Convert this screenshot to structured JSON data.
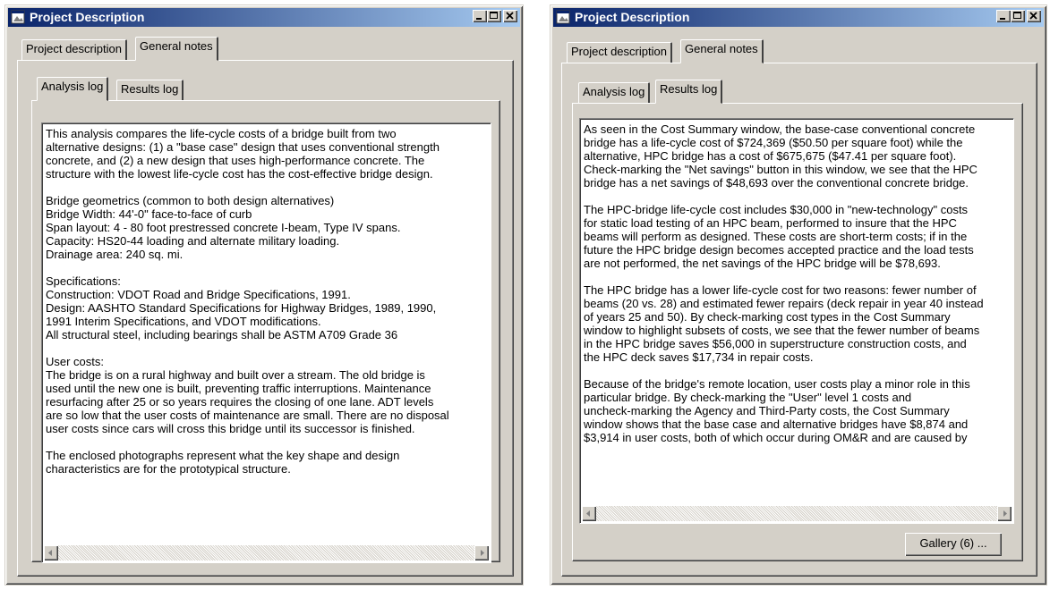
{
  "colors": {
    "titlebar_start": "#0a246a",
    "titlebar_end": "#a6caf0",
    "face": "#d4d0c8"
  },
  "icons": {
    "window": "window-icon",
    "minimize": "minimize-icon",
    "maximize": "maximize-icon",
    "close": "close-icon",
    "scroll_left": "arrow-left-icon",
    "scroll_right": "arrow-right-icon"
  },
  "left_window": {
    "title": "Project Description",
    "tabs": [
      "Project description",
      "General notes"
    ],
    "active_tab": "General notes",
    "subtabs": [
      "Analysis log",
      "Results log"
    ],
    "active_subtab": "Analysis log",
    "paragraphs": [
      "This analysis compares the life-cycle costs of a bridge built from two\nalternative designs: (1) a \"base case\" design that uses conventional strength\nconcrete, and (2) a new design that uses high-performance concrete. The\nstructure with the lowest life-cycle cost has the cost-effective bridge design.",
      "Bridge geometrics (common to both design alternatives)\nBridge Width: 44'-0\" face-to-face of curb\nSpan layout: 4 - 80 foot prestressed concrete I-beam, Type IV spans.\nCapacity: HS20-44 loading and alternate military loading.\nDrainage area: 240 sq. mi.",
      "Specifications:\nConstruction: VDOT Road and Bridge Specifications, 1991.\nDesign: AASHTO Standard Specifications for Highway Bridges, 1989, 1990,\n1991 Interim Specifications, and VDOT modifications.\nAll structural steel, including bearings shall be ASTM A709 Grade 36",
      "User costs:\nThe bridge is on a rural highway and built over a stream. The old bridge is\nused until the new one is built, preventing traffic interruptions. Maintenance\nresurfacing after 25 or so years requires the closing of one lane. ADT levels\nare so low that the user costs of maintenance are small. There are no disposal\nuser costs since cars will cross this bridge until its successor is finished.",
      "The enclosed photographs represent what the key shape and design\ncharacteristics are for the prototypical structure."
    ]
  },
  "right_window": {
    "title": "Project Description",
    "tabs": [
      "Project description",
      "General notes"
    ],
    "active_tab": "General notes",
    "subtabs": [
      "Analysis log",
      "Results log"
    ],
    "active_subtab": "Results log",
    "paragraphs": [
      "As seen in the Cost Summary window, the base-case conventional concrete\nbridge has a life-cycle cost of $724,369 ($50.50 per square foot) while the\nalternative, HPC bridge has a cost of $675,675 ($47.41 per square foot).\nCheck-marking the \"Net savings\" button in this window, we see that the HPC\nbridge has a net savings of $48,693 over the conventional concrete bridge.",
      "The HPC-bridge life-cycle cost includes $30,000 in \"new-technology\" costs\nfor static load testing of an HPC beam, performed to insure that the HPC\nbeams will perform as designed. These costs are short-term costs; if in the\nfuture the HPC bridge design becomes accepted practice and the load tests\nare not performed, the net savings of the HPC bridge will be $78,693.",
      "The HPC bridge has a lower life-cycle cost for two reasons: fewer number of\nbeams (20 vs. 28) and estimated fewer repairs (deck repair in year 40 instead\nof years 25 and 50). By check-marking cost types in the Cost Summary\nwindow to highlight subsets of costs, we see that the fewer number of beams\nin the HPC bridge saves $56,000 in superstructure construction costs, and\nthe HPC deck saves $17,734 in repair costs.",
      "Because of the bridge's remote location, user costs play a minor role in this\nparticular bridge. By check-marking the \"User\" level 1 costs and\nuncheck-marking the Agency and Third-Party costs, the Cost Summary\nwindow shows that the base case and alternative bridges have $8,874 and\n$3,914 in user costs, both of which occur during OM&R and are caused by"
    ],
    "gallery_button": "Gallery (6) ..."
  }
}
